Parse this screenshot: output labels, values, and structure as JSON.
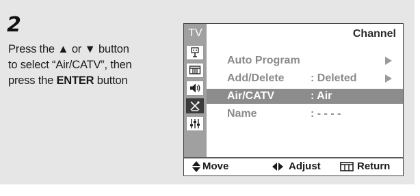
{
  "step": {
    "number": "2"
  },
  "instructions": {
    "line1_a": "Press the ",
    "up_glyph": "▲",
    "line1_b": " or ",
    "down_glyph": "▼",
    "line1_c": " button",
    "line2": "to select “Air/CATV”, then",
    "line3_a": "press the ",
    "enter_label": "ENTER",
    "line3_b": " button"
  },
  "osd": {
    "side_label": "TV",
    "title": "Channel",
    "side_icons": [
      "antenna-icon",
      "picture-icon",
      "sound-icon",
      "satellite-icon",
      "setup-icon"
    ],
    "active_side_icon": "satellite-icon",
    "menu": [
      {
        "label": "Auto Program",
        "value": "",
        "has_arrow": true,
        "selected": false
      },
      {
        "label": "Add/Delete",
        "value": ":  Deleted",
        "has_arrow": true,
        "selected": false
      },
      {
        "label": "Air/CATV",
        "value": ":  Air",
        "has_arrow": false,
        "selected": true
      },
      {
        "label": "Name",
        "value": ":  - - - -",
        "has_arrow": false,
        "selected": false
      }
    ],
    "footer": {
      "move_label": "Move",
      "adjust_label": "Adjust",
      "return_label": "Return"
    }
  },
  "colors": {
    "panel_bg": "#e6e6e6",
    "osd_sidebar": "#a0a0a0",
    "selected_row": "#8c8c8c",
    "disabled_text": "#8a8a8a"
  }
}
